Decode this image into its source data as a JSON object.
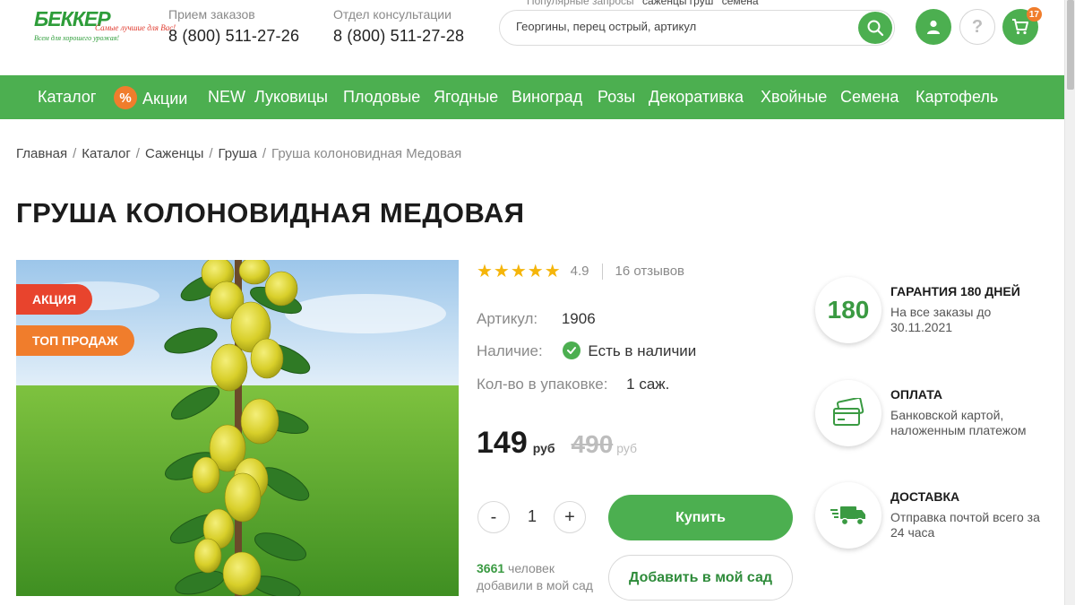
{
  "header": {
    "logo": {
      "word": "БЕККЕР",
      "slogan": "Самые лучшие для Вас!",
      "sub": "Всем для хорошего урожая!"
    },
    "popular": {
      "label": "Популярные запросы",
      "queries": [
        "саженцы груш",
        "семена"
      ]
    },
    "phones": [
      {
        "label": "Прием заказов",
        "number": "8 (800) 511-27-26"
      },
      {
        "label": "Отдел консультации",
        "number": "8 (800) 511-27-28"
      }
    ],
    "search": {
      "placeholder": "Георгины, перец острый, артикул"
    },
    "cart_count": "17",
    "help_symbol": "?"
  },
  "nav": {
    "items": [
      "Каталог",
      "Акции",
      "NEW",
      "Луковицы",
      "Плодовые",
      "Ягодные",
      "Виноград",
      "Розы",
      "Декоративка",
      "Хвойные",
      "Семена",
      "Картофель"
    ],
    "promo_symbol": "%"
  },
  "breadcrumb": {
    "items": [
      "Главная",
      "Каталог",
      "Саженцы",
      "Груша"
    ],
    "current": "Груша колоновидная Медовая",
    "separator": "/"
  },
  "product": {
    "title": "ГРУША КОЛОНОВИДНАЯ МЕДОВАЯ",
    "tags": [
      "АКЦИЯ",
      "ТОП ПРОДАЖ"
    ],
    "rating": {
      "stars": "★★★★★",
      "value": "4.9",
      "reviews": "16 отзывов"
    },
    "props": [
      {
        "key": "Артикул:",
        "value": "1906"
      },
      {
        "key": "Наличие:",
        "value": "Есть в наличии"
      },
      {
        "key": "Кол-во в упаковке:",
        "value": "1 саж."
      }
    ],
    "price": {
      "now": "149",
      "currency": "руб",
      "old": "490"
    },
    "qty": {
      "minus": "-",
      "value": "1",
      "plus": "+"
    },
    "buy_label": "Купить",
    "garden_label": "Добавить в мой сад",
    "added": {
      "count": "3661",
      "line1": "человек",
      "line2": "добавили в мой сад"
    }
  },
  "benefits": [
    {
      "badge": "180",
      "title": "ГАРАНТИЯ 180 ДНЕЙ",
      "text": "На все заказы до 30.11.2021"
    },
    {
      "title": "ОПЛАТА",
      "text": "Банковской картой, наложенным платежом"
    },
    {
      "title": "ДОСТАВКА",
      "text": "Отправка почтой всего за 24 часа"
    }
  ],
  "colors": {
    "brand_green": "#4caf50",
    "accent_orange": "#f07d2c",
    "sale_red": "#e8442d",
    "star": "#f5b50a"
  }
}
